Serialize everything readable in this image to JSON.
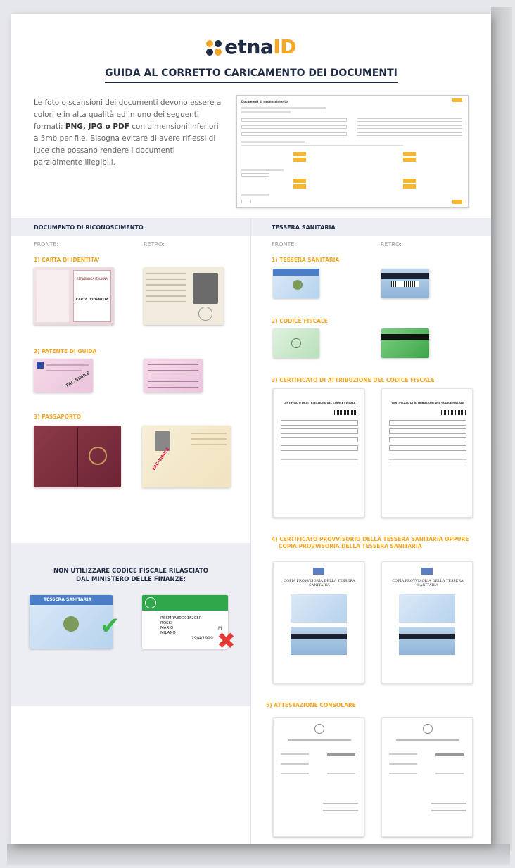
{
  "header": {
    "logo_etna": "etna",
    "logo_id": "ID",
    "title": "GUIDA AL CORRETTO CARICAMENTO DEI DOCUMENTI"
  },
  "intro": {
    "part1": "Le foto o scansioni dei documenti devono essere a colori e in alta qualità ed in uno dei seguenti formati: ",
    "formats": "PNG, JPG o PDF",
    "part2": " con dimensioni inferiori a 5mb per file. Bisogna evitare di avere riflessi di luce che possano rendere i documenti parzialmente illegibili."
  },
  "form_preview": {
    "title": "Documenti di riconoscimento"
  },
  "sections": {
    "left": {
      "title": "DOCUMENTO DI RICONOSCIMENTO",
      "front_label": "FRONTE:",
      "back_label": "RETRO:",
      "items": [
        "1) CARTA DI IDENTITA'",
        "2) PATENTE DI GUIDA",
        "3) PASSAPORTO"
      ]
    },
    "right": {
      "title": "TESSERA SANITARIA",
      "front_label": "FRONTE:",
      "back_label": "RETRO:",
      "items": [
        "1) TESSERA SANITARIA",
        "2) CODICE FISCALE",
        "3) CERTIFICATO DI ATTRIBUZIONE DEL CODICE FISCALE",
        "4) CERTIFICATO PROVVISORIO DELLA TESSERA SANITARIA OPPURE",
        "COPIA PROVVISORIA DELLA TESSERA SANITARIA",
        "5) ATTESTAZIONE CONSOLARE"
      ]
    }
  },
  "doc_text": {
    "id_card": "CARTA D'IDENTITÀ",
    "id_republic": "REPUBBLICA ITALIANA",
    "fac_simile": "FAC-SIMILE",
    "ts_title": "TESSERA SANITARIA",
    "copia_title": "COPIA PROVVISORIA DELLA TESSERA SANITARIA",
    "cert_title": "CERTIFICATO DI ATTRIBUZIONE DEL CODICE FISCALE"
  },
  "warning": {
    "line1": "NON UTILIZZARE CODICE FISCALE RILASCIATO",
    "line2": "DAL MINISTERO DELLE FINANZE:",
    "good_card_title": "TESSERA SANITARIA",
    "bad_card_code": "RSSMRA80D01F205R",
    "bad_card_surname": "ROSSI",
    "bad_card_name": "MARIO",
    "bad_card_city": "MILANO",
    "bad_card_sex": "M",
    "bad_card_date": "29/4/1999"
  },
  "colors": {
    "brand_dark": "#1f2a44",
    "brand_orange": "#f5a623",
    "ok_green": "#3bb54a",
    "ko_red": "#e53935"
  }
}
